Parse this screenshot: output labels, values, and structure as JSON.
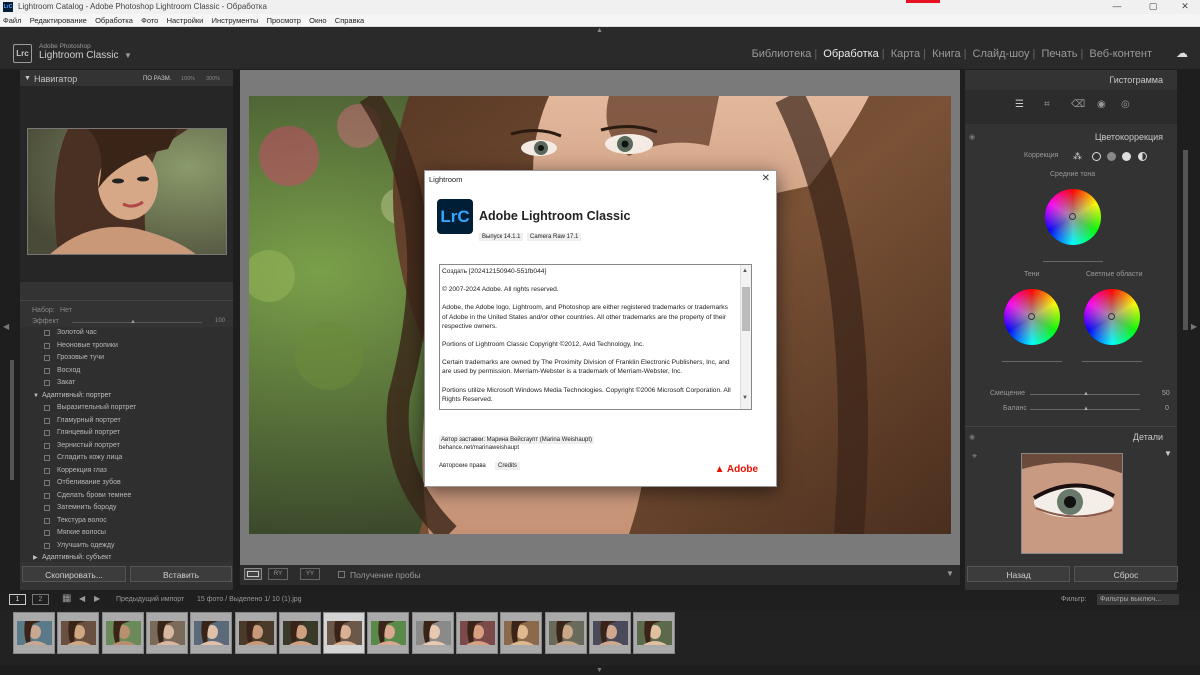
{
  "window": {
    "title": "Lightroom Catalog - Adobe Photoshop Lightroom Classic - Обработка",
    "app_icon": "LrC",
    "minimize": "—",
    "maximize": "▢",
    "close": "✕"
  },
  "menu": [
    "Файл",
    "Редактирование",
    "Обработка",
    "Фото",
    "Настройки",
    "Инструменты",
    "Просмотр",
    "Окно",
    "Справка"
  ],
  "identity": {
    "logo": "Lrc",
    "line1": "Adobe Photoshop",
    "line2": "Lightroom Classic",
    "arrow": "▼"
  },
  "modules": [
    "Библиотека",
    "Обработка",
    "Карта",
    "Книга",
    "Слайд-шоу",
    "Печать",
    "Веб-контент"
  ],
  "active_module_index": 1,
  "navigator": {
    "title": "Навигатор",
    "fit": "ПО РАЗМ.",
    "z1": "100%",
    "z2": "300%"
  },
  "presets": {
    "set_label": "Набор:",
    "set_value": "Нет",
    "effect_label": "Эффект",
    "effect_value": "100",
    "items": [
      {
        "kind": "item",
        "label": "Золотой час"
      },
      {
        "kind": "item",
        "label": "Неоновые тропики"
      },
      {
        "kind": "item",
        "label": "Грозовые тучи"
      },
      {
        "kind": "item",
        "label": "Восход"
      },
      {
        "kind": "item",
        "label": "Закат"
      },
      {
        "kind": "group",
        "label": "Адаптивный: портрет",
        "open": true
      },
      {
        "kind": "item",
        "label": "Выразительный портрет"
      },
      {
        "kind": "item",
        "label": "Гламурный портрет"
      },
      {
        "kind": "item",
        "label": "Глянцевый портрет"
      },
      {
        "kind": "item",
        "label": "Зернистый портрет"
      },
      {
        "kind": "item",
        "label": "Сгладить кожу лица"
      },
      {
        "kind": "item",
        "label": "Коррекция глаз"
      },
      {
        "kind": "item",
        "label": "Отбеливание зубов"
      },
      {
        "kind": "item",
        "label": "Сделать брови темнее"
      },
      {
        "kind": "item",
        "label": "Затемнить бороду"
      },
      {
        "kind": "item",
        "label": "Текстура волос"
      },
      {
        "kind": "item",
        "label": "Мягкие волосы"
      },
      {
        "kind": "item",
        "label": "Улучшить одежду"
      },
      {
        "kind": "group",
        "label": "Адаптивный: субъект",
        "open": false
      }
    ]
  },
  "left_buttons": {
    "copy": "Скопировать...",
    "paste": "Вставить"
  },
  "toolbar": {
    "softproof": "Получение пробы",
    "yy": "YY",
    "ry": "RY"
  },
  "right": {
    "histogram": "Гистограмма",
    "colorgrade": "Цветокоррекция",
    "correction_label": "Коррекция",
    "midtones": "Средние тона",
    "shadows": "Тени",
    "highlights": "Светлые области",
    "blend_label": "Смещение",
    "blend_value": "50",
    "balance_label": "Баланс",
    "balance_value": "0",
    "detail": "Детали",
    "prev_button": "Назад",
    "reset_button": "Сброс"
  },
  "filmbar": {
    "page1": "1",
    "page2": "2",
    "source": "Предыдущий импорт",
    "count": "15 фото / Выделено 1/ 10 (1).jpg",
    "filter_label": "Фильтр:",
    "filter_value": "Фильтры выключ..."
  },
  "film_count": 15,
  "film_selected_index": 7,
  "dialog": {
    "title": "Lightroom",
    "close": "✕",
    "icon": "LrC",
    "product": "Adobe Lightroom Classic",
    "version": "Выпуск 14.1.1",
    "camera_raw": "Camera Raw 17.1",
    "paragraphs": [
      "Создать [202412150940-551fb044]",
      "© 2007-2024 Adobe. All rights reserved.",
      "Adobe, the Adobe logo, Lightroom, and Photoshop are either registered trademarks or trademarks of Adobe in the United States and/or other countries. All other trademarks are the property of their respective owners.",
      "Portions of Lightroom Classic Copyright ©2012, Avid Technology, Inc.",
      "Certain trademarks are owned by The Proximity Division of Franklin Electronic Publishers, Inc, and are used by permission. Merriam-Webster is a trademark of Merriam-Webster, Inc.",
      "Portions utilize Microsoft Windows Media Technologies. Copyright ©2006 Microsoft Corporation. All Rights Reserved."
    ],
    "splash_author": "Автор заставки: Марина Вейсгаупт (Marina Weishaupt)",
    "splash_link": "behance.net/marinaweishaupt",
    "copyright_link": "Авторские права",
    "credits_link": "Credits",
    "adobe": "Adobe"
  },
  "colors": {
    "accent": "#31a8ff",
    "lrc_bg": "#001e36",
    "adobe_red": "#eb1000"
  }
}
